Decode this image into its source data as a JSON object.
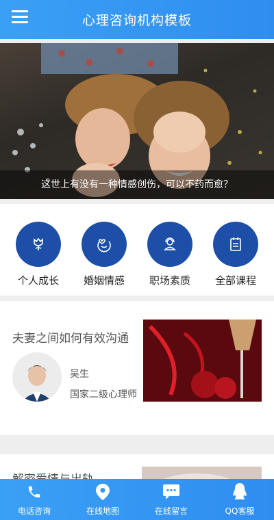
{
  "header": {
    "title": "心理咨询机构模板",
    "menu_icon": "menu-icon"
  },
  "banner": {
    "caption": "这世上有没有一种情感创伤，可以不药而愈？"
  },
  "categories": [
    {
      "label": "个人成长",
      "icon": "flower-icon"
    },
    {
      "label": "婚姻情感",
      "icon": "heart-face-icon"
    },
    {
      "label": "职场素质",
      "icon": "headset-person-icon"
    },
    {
      "label": "全部课程",
      "icon": "document-list-icon"
    }
  ],
  "articles": [
    {
      "title": "夫妻之间如何有效沟通",
      "author": "吴生",
      "role": "国家二级心理师"
    },
    {
      "title": "解密爱情与出轨"
    }
  ],
  "bottom_nav": [
    {
      "label": "电话咨询",
      "icon": "phone-icon"
    },
    {
      "label": "在线地图",
      "icon": "map-pin-icon"
    },
    {
      "label": "在线留言",
      "icon": "chat-bubble-icon"
    },
    {
      "label": "QQ客服",
      "icon": "qq-penguin-icon"
    }
  ],
  "colors": {
    "header": "#3aa0f5",
    "category_circle": "#1d4fa8",
    "background": "#eeeeee"
  }
}
